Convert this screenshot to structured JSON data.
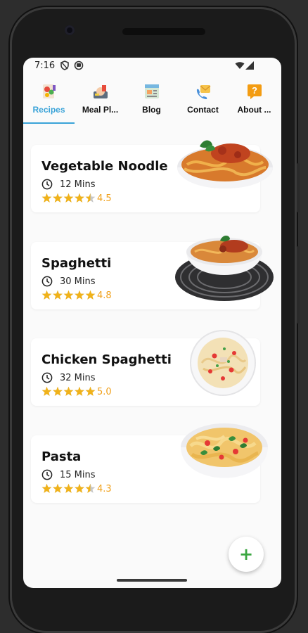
{
  "status": {
    "time": "7:16"
  },
  "tabs": [
    {
      "label": "Recipes",
      "icon": "recipes-icon",
      "active": true
    },
    {
      "label": "Meal Pl...",
      "icon": "meal-plan-icon",
      "active": false
    },
    {
      "label": "Blog",
      "icon": "blog-icon",
      "active": false
    },
    {
      "label": "Contact",
      "icon": "contact-icon",
      "active": false
    },
    {
      "label": "About ...",
      "icon": "about-icon",
      "active": false
    }
  ],
  "recipes": [
    {
      "title": "Vegetable Noodle",
      "time": "12 Mins",
      "rating": 4.5,
      "rating_label": "4.5",
      "image": "vegetable-noodle-image"
    },
    {
      "title": "Spaghetti",
      "time": "30 Mins",
      "rating": 4.8,
      "rating_label": "4.8",
      "image": "spaghetti-image"
    },
    {
      "title": "Chicken Spaghetti",
      "time": "32 Mins",
      "rating": 5.0,
      "rating_label": "5.0",
      "image": "chicken-spaghetti-image"
    },
    {
      "title": "Pasta",
      "time": "15 Mins",
      "rating": 4.3,
      "rating_label": "4.3",
      "image": "pasta-image"
    }
  ],
  "fab": {
    "label": "+"
  },
  "colors": {
    "accent": "#3aa3d8",
    "star": "#f0b21a",
    "rating_text": "#f0a01a",
    "fab_plus": "#3aa640"
  }
}
